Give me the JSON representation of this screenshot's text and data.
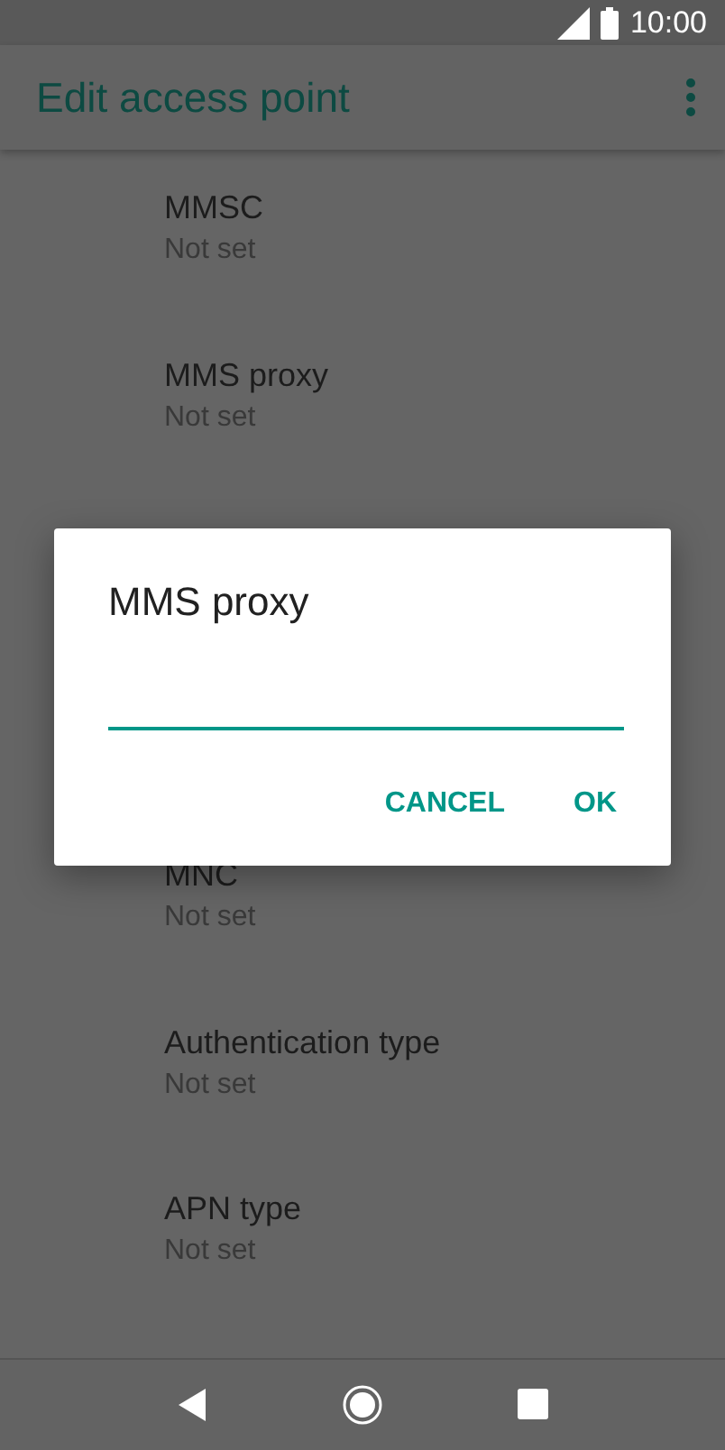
{
  "status_bar": {
    "time": "10:00"
  },
  "app_bar": {
    "title": "Edit access point"
  },
  "settings_above_dialog": [
    {
      "title": "MMSC",
      "value": "Not set"
    },
    {
      "title": "MMS proxy",
      "value": "Not set"
    }
  ],
  "settings_below_dialog": [
    {
      "title": "MNC",
      "value": "Not set"
    },
    {
      "title": "Authentication type",
      "value": "Not set"
    },
    {
      "title": "APN type",
      "value": "Not set"
    }
  ],
  "dialog": {
    "title": "MMS proxy",
    "buttons": [
      "CANCEL",
      "OK"
    ]
  }
}
